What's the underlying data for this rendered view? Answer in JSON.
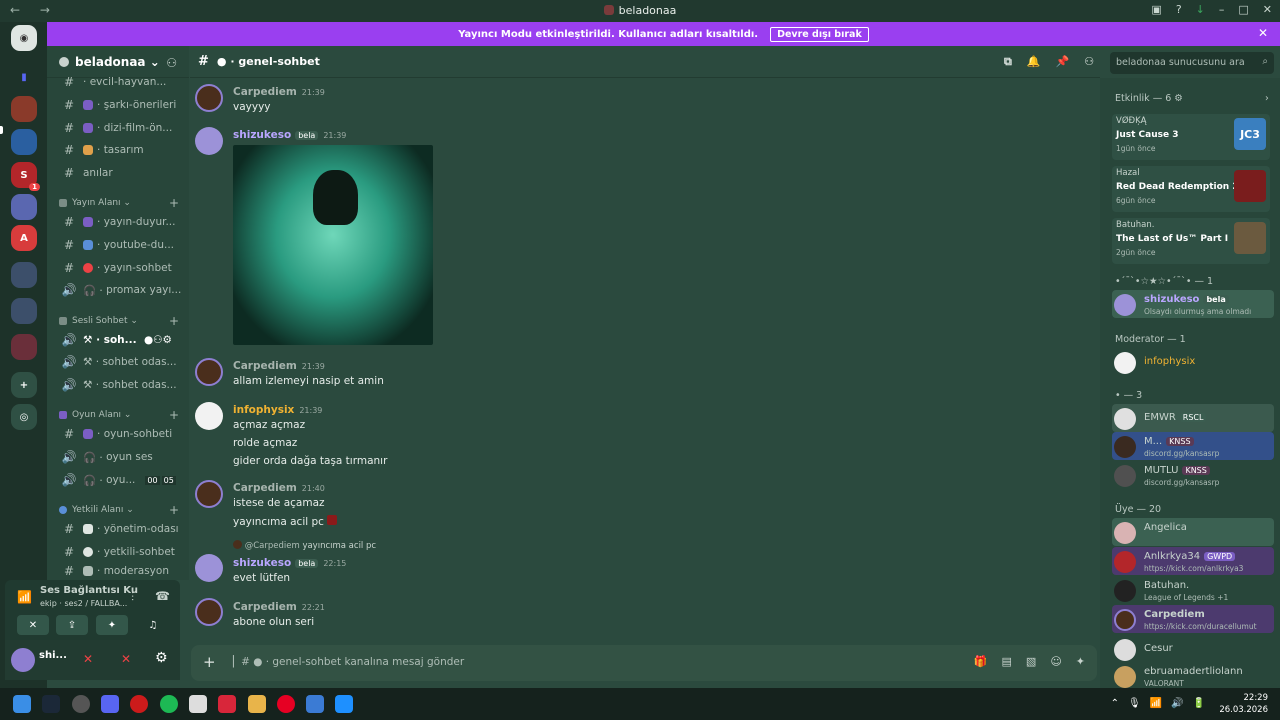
{
  "window": {
    "title": "beladonaa",
    "nav": "← →"
  },
  "banner": {
    "text": "Yayıncı Modu etkinleştirildi. Kullanıcı adları kısaltıldı.",
    "button": "Devre dışı bırak"
  },
  "server": {
    "name": "beladonaa"
  },
  "channels": {
    "top": [
      {
        "name": "evcil-hayvan...",
        "color": "#8a6a3f"
      },
      {
        "name": "şarkı-önerileri",
        "color": "#7b5ec4"
      },
      {
        "name": "dizi-film-ön...",
        "color": "#7b5ec4"
      },
      {
        "name": "tasarım",
        "color": "#e0a04a"
      },
      {
        "name": "anılar",
        "color": ""
      }
    ],
    "cat_yayin": "Yayın Alanı",
    "yayin": [
      {
        "name": "yayın-duyur...",
        "color": "#7b5ec4"
      },
      {
        "name": "youtube-du...",
        "color": "#5a8fd8"
      },
      {
        "name": "yayın-sohbet",
        "color": "#ed4245"
      },
      {
        "name": "promax yayı...",
        "color": ""
      }
    ],
    "cat_sesli": "Sesli Sohbet",
    "sesli": [
      {
        "name": "soh..."
      },
      {
        "name": "sohbet odas..."
      },
      {
        "name": "sohbet odas..."
      }
    ],
    "cat_oyun": "Oyun Alanı",
    "oyun": [
      {
        "name": "oyun-sohbeti"
      },
      {
        "name": "oyun ses"
      },
      {
        "name": "oyu...",
        "badge1": "00",
        "badge2": "05"
      }
    ],
    "cat_yetkili": "Yetkili Alanı",
    "yetkili": [
      {
        "name": "yönetim-odası"
      },
      {
        "name": "yetkili-sohbet"
      },
      {
        "name": "moderasyon"
      }
    ]
  },
  "voice": {
    "status": "Ses Bağlantısı Ku",
    "sub": "ekip · ses2 / FALLBA...",
    "user": "shi..."
  },
  "chat": {
    "channel": "genel-sohbet",
    "search_placeholder": "beladonaa sunucusunu ara",
    "messages": [
      {
        "author": "Carpediem",
        "time": "21:39",
        "text": "vayyyy"
      },
      {
        "author": "shizukeso",
        "tag": "bela",
        "time": "21:39"
      },
      {
        "author": "Carpediem",
        "time": "21:39",
        "text": "allam izlemeyi nasip et amin"
      },
      {
        "author": "infophysix",
        "time": "21:39",
        "lines": [
          "açmaz açmaz",
          "rolde açmaz",
          "gider orda dağa taşa tırmanır"
        ]
      },
      {
        "author": "Carpediem",
        "time": "21:40",
        "lines": [
          "istese de açamaz",
          "yayıncıma acil pc"
        ]
      },
      {
        "reply_to": "@Carpediem",
        "reply_text": "yayıncıma acil pc",
        "author": "shizukeso",
        "tag": "bela",
        "time": "22:15",
        "text": "evet lütfen"
      },
      {
        "author": "Carpediem",
        "time": "22:21",
        "text": "abone olun seri"
      }
    ],
    "composer_placeholder": "genel-sohbet kanalına mesaj gönder"
  },
  "members": {
    "activity_header": "Etkinlik — 6",
    "activities": [
      {
        "who": "VØĐĶĄ",
        "game": "Just Cause 3",
        "ago": "1gün önce",
        "cover": "#3a7fbf",
        "cover_text": "JC3"
      },
      {
        "who": "Hazal",
        "game": "Red Dead Redemption 2",
        "ago": "6gün önce",
        "cover": "#7a1d1d",
        "cover_text": ""
      },
      {
        "who": "Batuhan.",
        "game": "The Last of Us™ Part I",
        "ago": "2gün önce",
        "cover": "#6b5a3f",
        "cover_text": ""
      }
    ],
    "group1": "•´¯`•☆★☆•´¯`• — 1",
    "group1_members": [
      {
        "name": "shizukeso",
        "tag": "bela",
        "sub": "Olsaydı olurmuş ama olmadı"
      }
    ],
    "group2": "Moderator — 1",
    "group2_members": [
      {
        "name": "infophysix"
      }
    ],
    "group3": "• — 3",
    "group3_members": [
      {
        "name": "EMWR",
        "tag": "RSCL"
      },
      {
        "name": "M...",
        "tag": "KNSS",
        "sub": "discord.gg/kansasrp"
      },
      {
        "name": "MUTLU",
        "tag": "KNSS",
        "sub": "discord.gg/kansasrp"
      }
    ],
    "group4": "Üye — 20",
    "group4_members": [
      {
        "name": "Angelica"
      },
      {
        "name": "Anlkrkya34",
        "tag": "GWPD",
        "sub": "https://kick.com/anlkrkya3"
      },
      {
        "name": "Batuhan.",
        "sub": "League of Legends +1"
      },
      {
        "name": "Carpediem",
        "sub": "https://kick.com/duracellumut"
      },
      {
        "name": "Cesur"
      },
      {
        "name": "ebruamadertliolann",
        "sub": "VALORANT"
      }
    ]
  },
  "taskbar": {
    "time": "22:29",
    "date": "26.03.2026"
  }
}
